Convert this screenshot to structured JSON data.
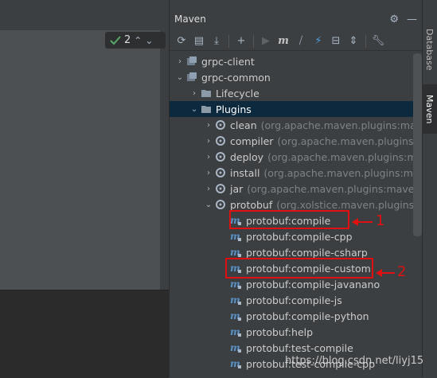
{
  "editor": {
    "inspection_count": "2"
  },
  "maven": {
    "title": "Maven",
    "tree": [
      {
        "label": "grpc-client",
        "arrow": "›",
        "type": "module"
      },
      {
        "label": "grpc-common",
        "arrow": "⌄",
        "type": "module"
      },
      {
        "label": "Lifecycle",
        "arrow": "›",
        "type": "folder"
      },
      {
        "label": "Plugins",
        "arrow": "⌄",
        "type": "folder"
      },
      {
        "label": "clean",
        "suffix": "(org.apache.maven.plugins:maven-c",
        "arrow": "›",
        "type": "plugin"
      },
      {
        "label": "compiler",
        "suffix": "(org.apache.maven.plugins:maven",
        "arrow": "›",
        "type": "plugin"
      },
      {
        "label": "deploy",
        "suffix": "(org.apache.maven.plugins:maven",
        "arrow": "›",
        "type": "plugin"
      },
      {
        "label": "install",
        "suffix": "(org.apache.maven.plugins:maven-i",
        "arrow": "›",
        "type": "plugin"
      },
      {
        "label": "jar",
        "suffix": "(org.apache.maven.plugins:maven-jar-",
        "arrow": "›",
        "type": "plugin"
      },
      {
        "label": "protobuf",
        "suffix": "(org.xolstice.maven.plugins:prot",
        "arrow": "⌄",
        "type": "plugin"
      },
      {
        "label": "protobuf:compile",
        "type": "goal"
      },
      {
        "label": "protobuf:compile-cpp",
        "type": "goal"
      },
      {
        "label": "protobuf:compile-csharp",
        "type": "goal"
      },
      {
        "label": "protobuf:compile-custom",
        "type": "goal"
      },
      {
        "label": "protobuf:compile-javanano",
        "type": "goal"
      },
      {
        "label": "protobuf:compile-js",
        "type": "goal"
      },
      {
        "label": "protobuf:compile-python",
        "type": "goal"
      },
      {
        "label": "protobuf:help",
        "type": "goal"
      },
      {
        "label": "protobuf:test-compile",
        "type": "goal"
      },
      {
        "label": "protobuf:test-compile-cpp",
        "type": "goal"
      }
    ]
  },
  "side_tabs": {
    "database": "Database",
    "maven": "Maven"
  },
  "annotations": {
    "label_1": "1",
    "label_2": "2"
  },
  "watermark": "https://blog.csdn.net/liyj15"
}
